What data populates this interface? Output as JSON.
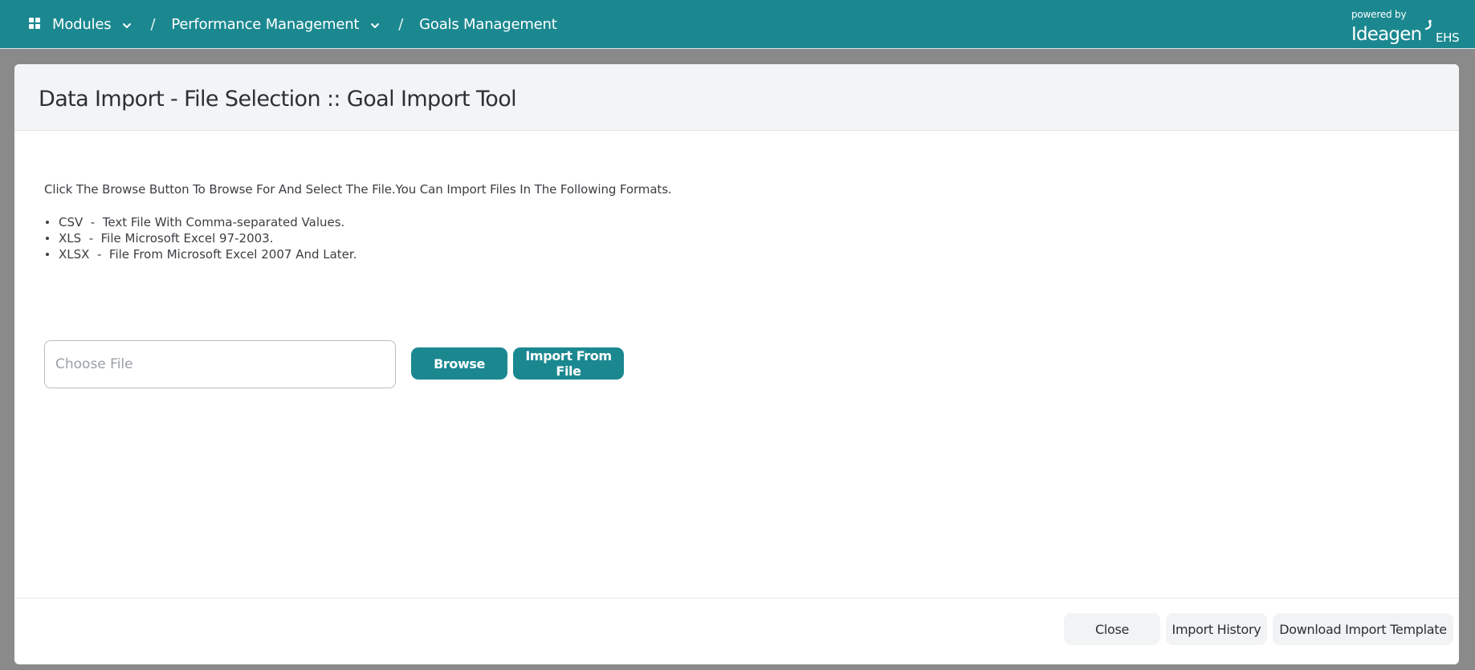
{
  "breadcrumb": {
    "modules": "Modules",
    "separator": "/",
    "performance": "Performance Management",
    "goals": "Goals Management"
  },
  "brand": {
    "powered_by": "powered by",
    "name": "Ideagen",
    "suffix": "EHS"
  },
  "page": {
    "title": "Data Import - File Selection :: Goal Import Tool",
    "instructions": "Click The Browse Button To Browse For And Select The File.You Can Import Files In The Following Formats.",
    "formats": [
      "CSV  -  Text File With Comma-separated Values.",
      "XLS  -  File Microsoft Excel 97-2003.",
      "XLSX  -  File From Microsoft Excel 2007 And Later."
    ]
  },
  "file_input": {
    "placeholder": "Choose File",
    "value": ""
  },
  "actions": {
    "browse": "Browse",
    "import_from_file": "Import From File"
  },
  "footer": {
    "close": "Close",
    "import_history": "Import History",
    "download_template": "Download Import Template"
  },
  "colors": {
    "accent": "#1b8890",
    "overlay": "#8a8a8a"
  },
  "icons": {
    "modules": "grid-icon",
    "dropdown": "chevron-down-icon",
    "brand_mark": "ideagen-mark-icon"
  }
}
